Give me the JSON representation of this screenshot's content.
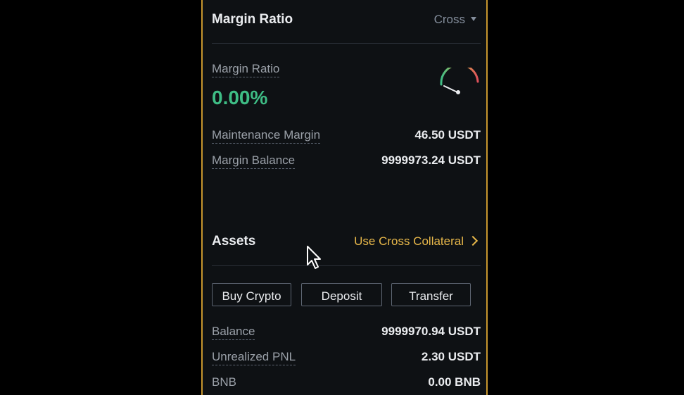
{
  "margin_section": {
    "title": "Margin Ratio",
    "mode": "Cross",
    "ratio_label": "Margin Ratio",
    "ratio_value": "0.00%",
    "rows": [
      {
        "label": "Maintenance Margin",
        "value": "46.50 USDT"
      },
      {
        "label": "Margin Balance",
        "value": "9999973.24 USDT"
      }
    ]
  },
  "assets_section": {
    "title": "Assets",
    "collateral_link": "Use Cross Collateral",
    "buttons": {
      "buy_crypto": "Buy Crypto",
      "deposit": "Deposit",
      "transfer": "Transfer"
    },
    "rows": [
      {
        "label": "Balance",
        "value": "9999970.94 USDT"
      },
      {
        "label": "Unrealized PNL",
        "value": "2.30 USDT"
      },
      {
        "label": "BNB",
        "value": "0.00 BNB"
      }
    ]
  },
  "colors": {
    "accent": "#c7962e",
    "positive": "#3ebd85",
    "link": "#e8b84a",
    "background": "#0e1114"
  },
  "icons": [
    "caret-down-icon",
    "gauge-icon",
    "chevron-right-icon",
    "mouse-cursor-icon"
  ]
}
